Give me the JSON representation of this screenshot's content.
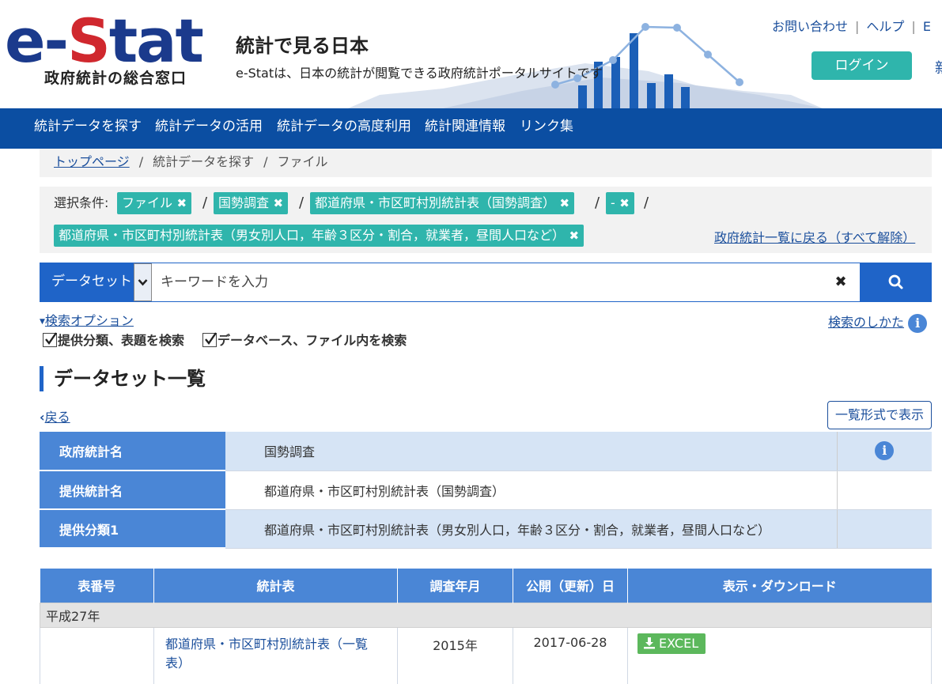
{
  "header": {
    "logo_e": "e-",
    "logo_s": "S",
    "logo_rest": "tat",
    "logo_sub": "政府統計の総合窓口",
    "site_title": "統計で見る日本",
    "site_desc": "e-Statは、日本の統計が閲覧できる政府統計ポータルサイトです",
    "top_links": [
      "お問い合わせ",
      "ヘルプ",
      "E"
    ],
    "login_label": "ログイン",
    "edge_char": "新"
  },
  "nav": {
    "items": [
      "統計データを探す",
      "統計データの活用",
      "統計データの高度利用",
      "統計関連情報",
      "リンク集"
    ]
  },
  "breadcrumb": {
    "items": [
      "トップページ",
      "統計データを探す",
      "ファイル"
    ]
  },
  "conditions": {
    "label": "選択条件:",
    "chips": [
      "ファイル",
      "国勢調査",
      "都道府県・市区町村別統計表（国勢調査）",
      "-",
      "都道府県・市区町村別統計表（男女別人口，年齢３区分・割合，就業者，昼間人口など）"
    ],
    "reset_link": "政府統計一覧に戻る（すべて解除）"
  },
  "search": {
    "type_label": "データセット",
    "placeholder": "キーワードを入力",
    "clear_icon": "close-icon",
    "button_icon": "search-icon"
  },
  "options": {
    "toggle_label": "検索オプション",
    "howto_label": "検索のしかた",
    "checkbox1": "提供分類、表題を検索",
    "checkbox2": "データベース、ファイル内を検索"
  },
  "section": {
    "title": "データセット一覧",
    "back_label": "戻る",
    "list_button": "一覧形式で表示"
  },
  "info_table": {
    "rows": [
      {
        "label": "政府統計名",
        "value": "国勢調査"
      },
      {
        "label": "提供統計名",
        "value": "都道府県・市区町村別統計表（国勢調査）"
      },
      {
        "label": "提供分類1",
        "value": "都道府県・市区町村別統計表（男女別人口，年齢３区分・割合，就業者，昼間人口など）"
      }
    ]
  },
  "data_table": {
    "headers": [
      "表番号",
      "統計表",
      "調査年月",
      "公開（更新）日",
      "表示・ダウンロード"
    ],
    "year_group": "平成27年",
    "rows": [
      {
        "number": "",
        "title": "都道府県・市区町村別統計表（一覧表）",
        "survey": "2015年",
        "published": "2017-06-28",
        "download": "EXCEL"
      }
    ]
  },
  "colors": {
    "nav_blue": "#0b4ea2",
    "accent_blue": "#1f64c8",
    "teal": "#2fb5ac",
    "logo_red": "#d0282e",
    "excel_green": "#5cb85c"
  }
}
